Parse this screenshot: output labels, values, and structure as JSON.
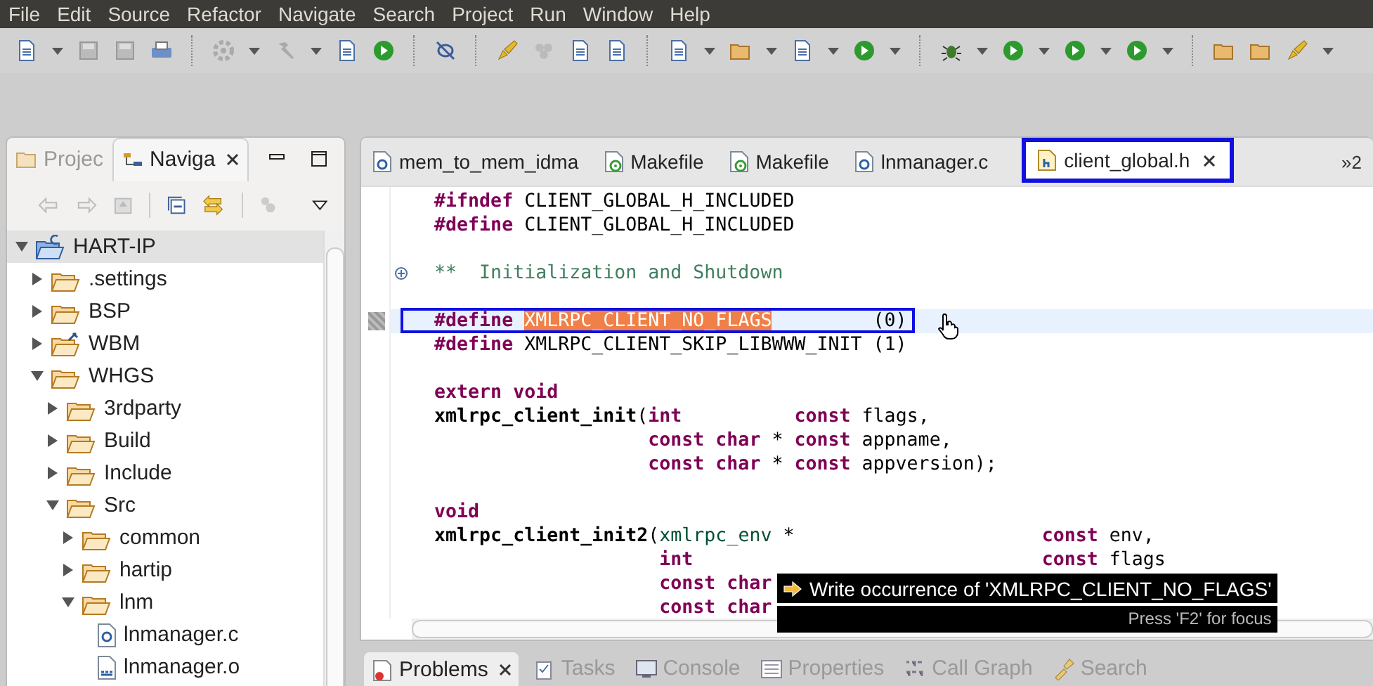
{
  "menu": [
    "File",
    "Edit",
    "Source",
    "Refactor",
    "Navigate",
    "Search",
    "Project",
    "Run",
    "Window",
    "Help"
  ],
  "navigator": {
    "tabs": [
      {
        "label": "Projec",
        "kind": "project",
        "selected": false
      },
      {
        "label": "Naviga",
        "kind": "navigator",
        "selected": true
      }
    ],
    "tree": [
      {
        "label": "HART-IP",
        "kind": "project",
        "expanded": true,
        "selected": true,
        "children": [
          {
            "label": ".settings",
            "kind": "folder",
            "expanded": false,
            "selected": false
          },
          {
            "label": "BSP",
            "kind": "folder",
            "expanded": false,
            "selected": false
          },
          {
            "label": "WBM",
            "kind": "tool-folder",
            "expanded": false,
            "selected": false
          },
          {
            "label": "WHGS",
            "kind": "folder",
            "expanded": true,
            "selected": false,
            "children": [
              {
                "label": "3rdparty",
                "kind": "folder",
                "expanded": false,
                "selected": false
              },
              {
                "label": "Build",
                "kind": "folder",
                "expanded": false,
                "selected": false
              },
              {
                "label": "Include",
                "kind": "folder",
                "expanded": false,
                "selected": false
              },
              {
                "label": "Src",
                "kind": "folder",
                "expanded": true,
                "selected": false,
                "children": [
                  {
                    "label": "common",
                    "kind": "folder",
                    "expanded": false,
                    "selected": false
                  },
                  {
                    "label": "hartip",
                    "kind": "folder",
                    "expanded": false,
                    "selected": false
                  },
                  {
                    "label": "lnm",
                    "kind": "folder",
                    "expanded": true,
                    "selected": false,
                    "children": [
                      {
                        "label": "lnmanager.c",
                        "kind": "c-file",
                        "selected": false
                      },
                      {
                        "label": "lnmanager.o",
                        "kind": "object-file",
                        "selected": false
                      }
                    ]
                  }
                ]
              }
            ]
          }
        ]
      }
    ]
  },
  "editor": {
    "tabs": [
      {
        "label": "mem_to_mem_idma",
        "kind": "c-file",
        "selected": false
      },
      {
        "label": "Makefile",
        "kind": "makefile",
        "selected": false
      },
      {
        "label": "Makefile",
        "kind": "makefile",
        "selected": false
      },
      {
        "label": "lnmanager.c",
        "kind": "c-file",
        "selected": false
      },
      {
        "label": "client_global.h",
        "kind": "h-file",
        "selected": true
      }
    ],
    "overflow": "»2",
    "lines": [
      {
        "kind": "code",
        "current": false,
        "segments": [
          {
            "kind": "kw",
            "text": "#ifndef"
          },
          {
            "kind": "plain",
            "text": " CLIENT_GLOBAL_H_INCLUDED"
          }
        ]
      },
      {
        "kind": "code",
        "current": false,
        "segments": [
          {
            "kind": "kw",
            "text": "#define"
          },
          {
            "kind": "plain",
            "text": " CLIENT_GLOBAL_H_INCLUDED"
          }
        ]
      },
      {
        "kind": "blank",
        "current": false
      },
      {
        "kind": "fold",
        "current": false,
        "segments": [
          {
            "kind": "comment",
            "text": "**  Initialization and Shutdown"
          }
        ]
      },
      {
        "kind": "blank",
        "current": false
      },
      {
        "kind": "code",
        "current": true,
        "segments": [
          {
            "kind": "kw",
            "text": "#define"
          },
          {
            "kind": "occurrence",
            "text": " XMLRPC_CLIENT_NO_FLAGS"
          },
          {
            "kind": "plain",
            "text": "         (0)"
          }
        ]
      },
      {
        "kind": "code",
        "current": false,
        "segments": [
          {
            "kind": "kw",
            "text": "#define"
          },
          {
            "kind": "plain",
            "text": " XMLRPC_CLIENT_SKIP_LIBWWW_INIT (1)"
          }
        ]
      },
      {
        "kind": "blank",
        "current": false
      },
      {
        "kind": "code",
        "current": false,
        "segments": [
          {
            "kind": "kw",
            "text": "extern void"
          }
        ]
      },
      {
        "kind": "code",
        "current": false,
        "segments": [
          {
            "kind": "func",
            "text": "xmlrpc_client_init"
          },
          {
            "kind": "plain",
            "text": "("
          },
          {
            "kind": "kw",
            "text": "int"
          },
          {
            "kind": "kw",
            "text": "          const"
          },
          {
            "kind": "plain",
            "text": " flags,"
          }
        ]
      },
      {
        "kind": "code",
        "current": false,
        "segments": [
          {
            "kind": "kw",
            "text": "                   const char"
          },
          {
            "kind": "plain",
            "text": " * "
          },
          {
            "kind": "kw",
            "text": "const"
          },
          {
            "kind": "plain",
            "text": " appname,"
          }
        ]
      },
      {
        "kind": "code",
        "current": false,
        "segments": [
          {
            "kind": "kw",
            "text": "                   const char"
          },
          {
            "kind": "plain",
            "text": " * "
          },
          {
            "kind": "kw",
            "text": "const"
          },
          {
            "kind": "plain",
            "text": " appversion);"
          }
        ]
      },
      {
        "kind": "blank",
        "current": false
      },
      {
        "kind": "code",
        "current": false,
        "segments": [
          {
            "kind": "kw",
            "text": "void"
          }
        ]
      },
      {
        "kind": "code",
        "current": false,
        "segments": [
          {
            "kind": "func",
            "text": "xmlrpc_client_init2"
          },
          {
            "kind": "plain",
            "text": "("
          },
          {
            "kind": "type",
            "text": "xmlrpc_env"
          },
          {
            "kind": "plain",
            "text": " *                      "
          },
          {
            "kind": "kw",
            "text": "const"
          },
          {
            "kind": "plain",
            "text": " env,"
          }
        ]
      },
      {
        "kind": "code",
        "current": false,
        "segments": [
          {
            "kind": "kw",
            "text": "                    int"
          },
          {
            "kind": "kw",
            "text": "                               const"
          },
          {
            "kind": "plain",
            "text": " flags"
          }
        ]
      },
      {
        "kind": "code",
        "current": false,
        "segments": [
          {
            "kind": "kw",
            "text": "                    const char"
          }
        ]
      },
      {
        "kind": "code",
        "current": false,
        "segments": [
          {
            "kind": "kw",
            "text": "                    const char"
          }
        ]
      }
    ],
    "tooltip": {
      "title": "Write occurrence of 'XMLRPC_CLIENT_NO_FLAGS'",
      "hint": "Press 'F2' for focus"
    }
  },
  "bottom_tabs": [
    {
      "label": "Problems",
      "kind": "problems",
      "selected": true
    },
    {
      "label": "Tasks",
      "kind": "tasks",
      "selected": false
    },
    {
      "label": "Console",
      "kind": "console",
      "selected": false
    },
    {
      "label": "Properties",
      "kind": "properties",
      "selected": false
    },
    {
      "label": "Call Graph",
      "kind": "callgraph",
      "selected": false
    },
    {
      "label": "Search",
      "kind": "search",
      "selected": false
    }
  ]
}
